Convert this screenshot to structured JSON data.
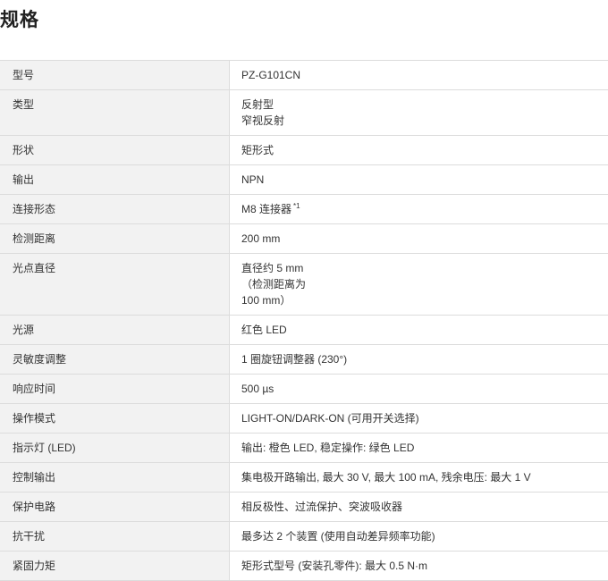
{
  "title": "规格",
  "rows": [
    {
      "label": "型号",
      "lines": [
        "PZ-G101CN"
      ]
    },
    {
      "label": "类型",
      "lines": [
        "反射型",
        "窄视反射"
      ]
    },
    {
      "label": "形状",
      "lines": [
        "矩形式"
      ]
    },
    {
      "label": "输出",
      "lines": [
        "NPN"
      ]
    },
    {
      "label": "连接形态",
      "lines": [
        "M8 连接器"
      ],
      "note": "*1"
    },
    {
      "label": "检测距离",
      "lines": [
        "200 mm"
      ]
    },
    {
      "label": "光点直径",
      "lines": [
        "直径约 5 mm",
        "（检测距离为",
        "100 mm）"
      ]
    },
    {
      "label": "光源",
      "lines": [
        "红色 LED"
      ]
    },
    {
      "label": "灵敏度调整",
      "lines": [
        "1 圈旋钮调整器 (230°)"
      ]
    },
    {
      "label": "响应时间",
      "lines": [
        "500 µs"
      ]
    },
    {
      "label": "操作模式",
      "lines": [
        "LIGHT-ON/DARK-ON (可用开关选择)"
      ]
    },
    {
      "label": "指示灯 (LED)",
      "lines": [
        "输出: 橙色 LED, 稳定操作: 绿色 LED"
      ]
    },
    {
      "label": "控制输出",
      "lines": [
        "集电极开路输出, 最大 30 V, 最大 100 mA, 残余电压: 最大 1 V"
      ]
    },
    {
      "label": "保护电路",
      "lines": [
        "相反极性、过流保护、突波吸收器"
      ]
    },
    {
      "label": "抗干扰",
      "lines": [
        "最多达 2 个装置 (使用自动差异频率功能)"
      ]
    },
    {
      "label": "紧固力矩",
      "lines": [
        "矩形式型号 (安装孔零件): 最大 0.5 N·m"
      ]
    }
  ]
}
